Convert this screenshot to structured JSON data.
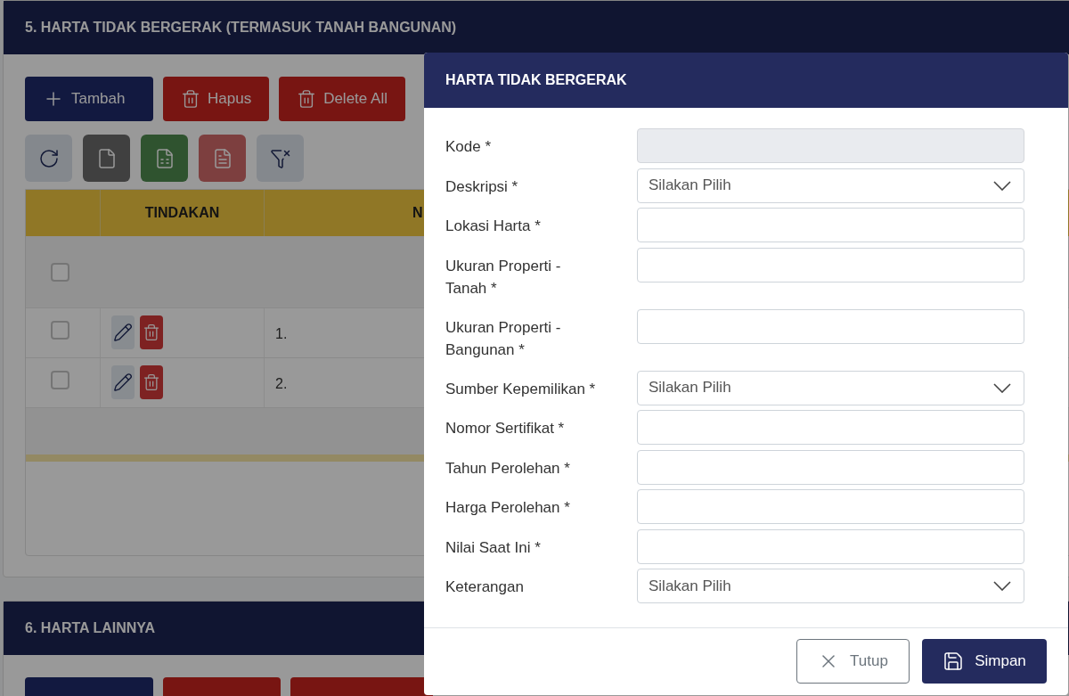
{
  "section_5": {
    "title": "5. HARTA TIDAK BERGERAK (TERMASUK TANAH BANGUNAN)",
    "buttons": [
      {
        "kind": "add",
        "label": "Tambah"
      },
      {
        "kind": "delete",
        "label": "Hapus"
      },
      {
        "kind": "delete",
        "label": "Delete All"
      }
    ],
    "tools": [
      {
        "kind": "refresh"
      },
      {
        "kind": "file"
      },
      {
        "kind": "excel"
      },
      {
        "kind": "pdf"
      },
      {
        "kind": "filter"
      }
    ],
    "table": {
      "columns": [
        "TINDAKAN",
        "N"
      ],
      "header_checked": false,
      "rows": [
        {
          "checked": false,
          "number": "1."
        },
        {
          "checked": false,
          "number": "2."
        }
      ]
    }
  },
  "section_6": {
    "title": "6. HARTA LAINNYA",
    "buttons": [
      {
        "kind": "add"
      },
      {
        "kind": "delete"
      },
      {
        "kind": "delete"
      }
    ]
  },
  "modal": {
    "title": "HARTA TIDAK BERGERAK",
    "fields": [
      {
        "label": "Kode *",
        "kind": "readonly"
      },
      {
        "label": "Deskripsi *",
        "kind": "select",
        "value": "Silakan Pilih"
      },
      {
        "label": "Lokasi Harta *",
        "kind": "text"
      },
      {
        "label": "Ukuran Properti - Tanah *",
        "kind": "text"
      },
      {
        "label": "Ukuran Properti - Bangunan *",
        "kind": "text"
      },
      {
        "label": "Sumber Kepemilikan *",
        "kind": "select",
        "value": "Silakan Pilih"
      },
      {
        "label": "Nomor Sertifikat *",
        "kind": "text"
      },
      {
        "label": "Tahun Perolehan *",
        "kind": "text"
      },
      {
        "label": "Harga Perolehan *",
        "kind": "text"
      },
      {
        "label": "Nilai Saat Ini *",
        "kind": "text"
      },
      {
        "label": "Keterangan",
        "kind": "select",
        "value": "Silakan Pilih"
      }
    ],
    "footer_buttons": [
      {
        "kind": "close",
        "label": "Tutup"
      },
      {
        "kind": "save",
        "label": "Simpan"
      }
    ]
  }
}
